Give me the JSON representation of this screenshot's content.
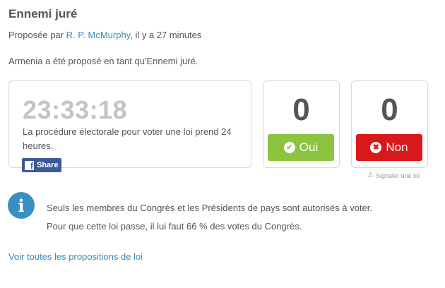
{
  "title": "Ennemi juré",
  "proposed": {
    "prefix": "Proposée par ",
    "author": "R. P. McMurphy",
    "suffix": ", il y a 27 minutes"
  },
  "description": "Armenia a été proposé en tant qu'Ennemi juré.",
  "timer": {
    "value": "23:33:18",
    "text": "La procédure électorale pour voter une loi prend 24 heures."
  },
  "share": {
    "label": "Share",
    "icon": "f"
  },
  "votes": {
    "yes": {
      "count": "0",
      "label": "Oui",
      "icon": "✔"
    },
    "no": {
      "count": "0",
      "label": "Non",
      "icon": "✖"
    }
  },
  "report": {
    "label": "Signaler une loi"
  },
  "info": {
    "line1": "Seuls les membres du Congrès et les Présidents de pays sont autorisés à voter.",
    "line2": "Pour que cette loi passe, il lui faut 66 % des votes du Congrès."
  },
  "all_link": "Voir toutes les propositions de loi",
  "colors": {
    "link": "#3f88b6",
    "yes": "#8cc43f",
    "no": "#d8191a",
    "facebook": "#3b5998",
    "info": "#3b8ec3"
  }
}
